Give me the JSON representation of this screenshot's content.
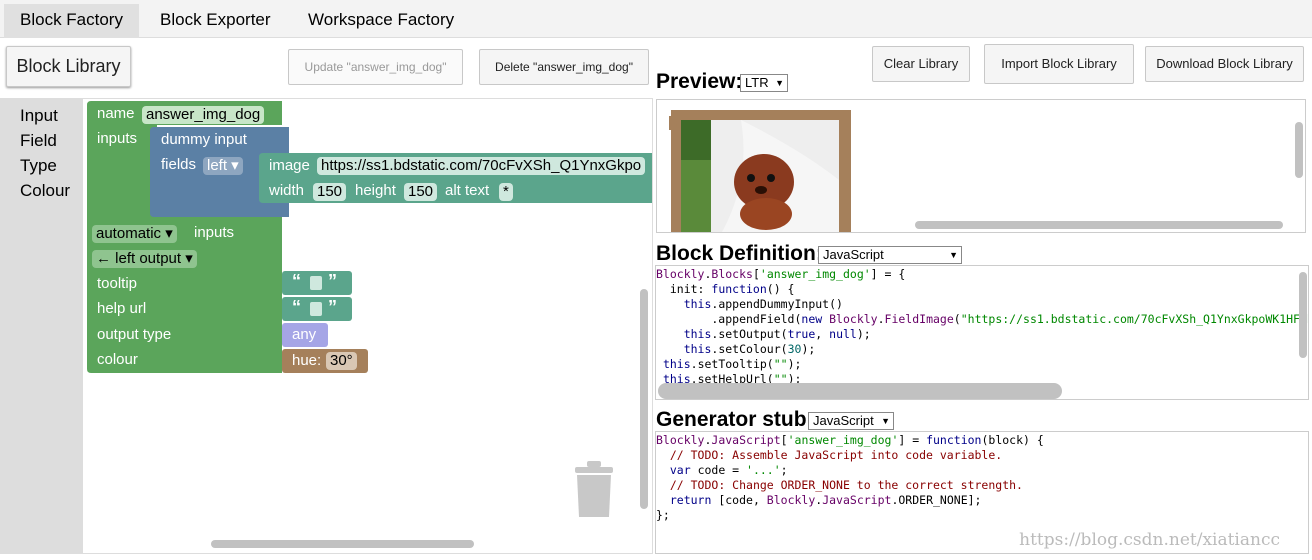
{
  "tabs": [
    "Block Factory",
    "Block Exporter",
    "Workspace Factory"
  ],
  "toolbar": {
    "block_library": "Block Library",
    "update": "Update \"answer_img_dog\"",
    "delete": "Delete \"answer_img_dog\"",
    "clear": "Clear Library",
    "import": "Import Block Library",
    "download": "Download Block Library"
  },
  "toolbox": [
    "Input",
    "Field",
    "Type",
    "Colour"
  ],
  "blocks": {
    "name_label": "name",
    "name_value": "answer_img_dog",
    "inputs_label": "inputs",
    "dummy_input": "dummy input",
    "fields_label": "fields",
    "fields_align": "left",
    "image_label": "image",
    "image_url": "https://ss1.bdstatic.com/70cFvXSh_Q1YnxGkpo",
    "width_label": "width",
    "width_value": "150",
    "height_label": "height",
    "height_value": "150",
    "alt_label": "alt text",
    "alt_value": "*",
    "automatic": "automatic",
    "inputs_label2": "inputs",
    "left_output": "← left output",
    "tooltip": "tooltip",
    "help_url": "help url",
    "output_type": "output type",
    "colour": "colour",
    "quote_open": "“",
    "quote_close": "”",
    "any": "any",
    "hue_label": "hue:",
    "hue_value": "30°"
  },
  "preview": {
    "title": "Preview:",
    "direction": "LTR"
  },
  "definition": {
    "title": "Block Definition:",
    "format": "JavaScript"
  },
  "generator": {
    "title": "Generator stub:",
    "format": "JavaScript"
  },
  "colors": {
    "block_green": "#5ba55b",
    "block_blue": "#5b80a5",
    "block_teal": "#5ba58c",
    "block_purple": "#a5a5e6",
    "block_brown": "#a5805b"
  },
  "watermark": "https://blog.csdn.net/xiatiancc"
}
